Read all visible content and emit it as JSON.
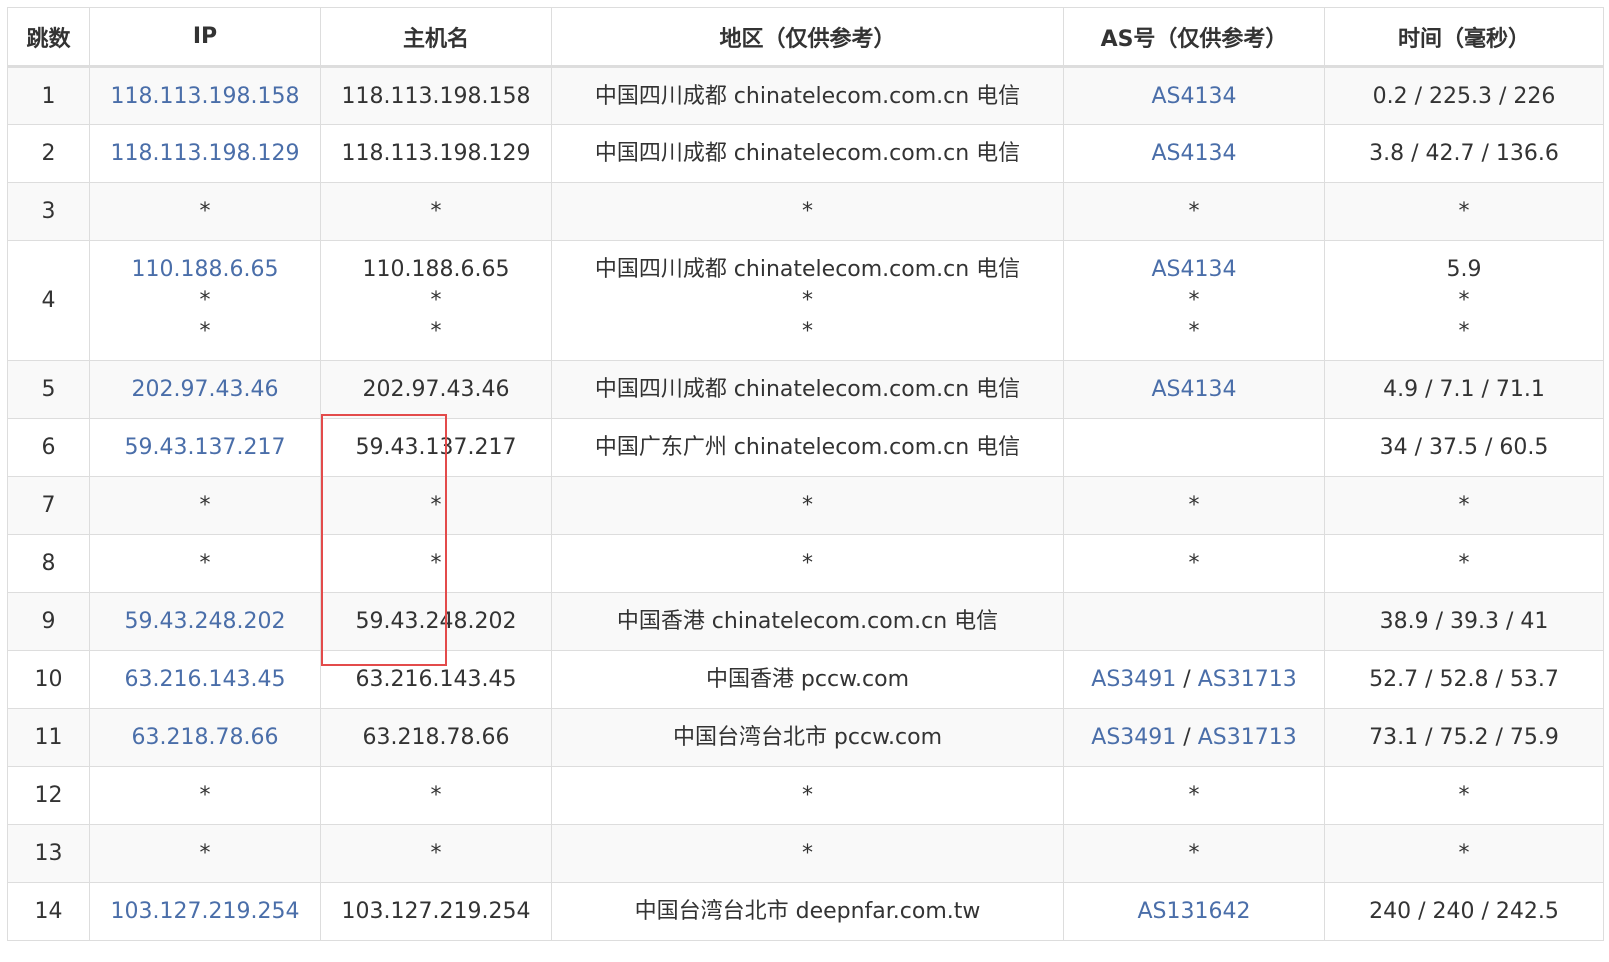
{
  "colors": {
    "link": "#4a6ea9",
    "highlight": "#e34b4b",
    "border": "#dddddd",
    "stripe": "#f9f9f9"
  },
  "headers": [
    "跳数",
    "IP",
    "主机名",
    "地区（仅供参考）",
    "AS号（仅供参考）",
    "时间（毫秒）"
  ],
  "rows": [
    {
      "hop": "1",
      "ip": [
        "118.113.198.158"
      ],
      "host": [
        "118.113.198.158"
      ],
      "region": [
        "中国四川成都 chinatelecom.com.cn 电信"
      ],
      "as": [
        [
          "AS4134"
        ]
      ],
      "time": [
        "0.2 / 225.3 / 226"
      ]
    },
    {
      "hop": "2",
      "ip": [
        "118.113.198.129"
      ],
      "host": [
        "118.113.198.129"
      ],
      "region": [
        "中国四川成都 chinatelecom.com.cn 电信"
      ],
      "as": [
        [
          "AS4134"
        ]
      ],
      "time": [
        "3.8 / 42.7 / 136.6"
      ]
    },
    {
      "hop": "3",
      "ip": [
        "*"
      ],
      "host": [
        "*"
      ],
      "region": [
        "*"
      ],
      "as": [
        [
          "*"
        ]
      ],
      "time": [
        "*"
      ]
    },
    {
      "hop": "4",
      "ip": [
        "110.188.6.65",
        "*",
        "*"
      ],
      "host": [
        "110.188.6.65",
        "*",
        "*"
      ],
      "region": [
        "中国四川成都 chinatelecom.com.cn 电信",
        "*",
        "*"
      ],
      "as": [
        [
          "AS4134"
        ],
        [
          "*"
        ],
        [
          "*"
        ]
      ],
      "time": [
        "5.9",
        "*",
        "*"
      ]
    },
    {
      "hop": "5",
      "ip": [
        "202.97.43.46"
      ],
      "host": [
        "202.97.43.46"
      ],
      "region": [
        "中国四川成都 chinatelecom.com.cn 电信"
      ],
      "as": [
        [
          "AS4134"
        ]
      ],
      "time": [
        "4.9 / 7.1 / 71.1"
      ]
    },
    {
      "hop": "6",
      "ip": [
        "59.43.137.217"
      ],
      "host": [
        "59.43.137.217"
      ],
      "region": [
        "中国广东广州 chinatelecom.com.cn 电信"
      ],
      "as": [
        []
      ],
      "time": [
        "34 / 37.5 / 60.5"
      ]
    },
    {
      "hop": "7",
      "ip": [
        "*"
      ],
      "host": [
        "*"
      ],
      "region": [
        "*"
      ],
      "as": [
        [
          "*"
        ]
      ],
      "time": [
        "*"
      ]
    },
    {
      "hop": "8",
      "ip": [
        "*"
      ],
      "host": [
        "*"
      ],
      "region": [
        "*"
      ],
      "as": [
        [
          "*"
        ]
      ],
      "time": [
        "*"
      ]
    },
    {
      "hop": "9",
      "ip": [
        "59.43.248.202"
      ],
      "host": [
        "59.43.248.202"
      ],
      "region": [
        "中国香港 chinatelecom.com.cn 电信"
      ],
      "as": [
        []
      ],
      "time": [
        "38.9 / 39.3 / 41"
      ]
    },
    {
      "hop": "10",
      "ip": [
        "63.216.143.45"
      ],
      "host": [
        "63.216.143.45"
      ],
      "region": [
        "中国香港 pccw.com"
      ],
      "as": [
        [
          "AS3491",
          "AS31713"
        ]
      ],
      "time": [
        "52.7 / 52.8 / 53.7"
      ]
    },
    {
      "hop": "11",
      "ip": [
        "63.218.78.66"
      ],
      "host": [
        "63.218.78.66"
      ],
      "region": [
        "中国台湾台北市 pccw.com"
      ],
      "as": [
        [
          "AS3491",
          "AS31713"
        ]
      ],
      "time": [
        "73.1 / 75.2 / 75.9"
      ]
    },
    {
      "hop": "12",
      "ip": [
        "*"
      ],
      "host": [
        "*"
      ],
      "region": [
        "*"
      ],
      "as": [
        [
          "*"
        ]
      ],
      "time": [
        "*"
      ]
    },
    {
      "hop": "13",
      "ip": [
        "*"
      ],
      "host": [
        "*"
      ],
      "region": [
        "*"
      ],
      "as": [
        [
          "*"
        ]
      ],
      "time": [
        "*"
      ]
    },
    {
      "hop": "14",
      "ip": [
        "103.127.219.254"
      ],
      "host": [
        "103.127.219.254"
      ],
      "region": [
        "中国台湾台北市 deepnfar.com.tw"
      ],
      "as": [
        [
          "AS131642"
        ]
      ],
      "time": [
        "240 / 240 / 242.5"
      ]
    }
  ]
}
